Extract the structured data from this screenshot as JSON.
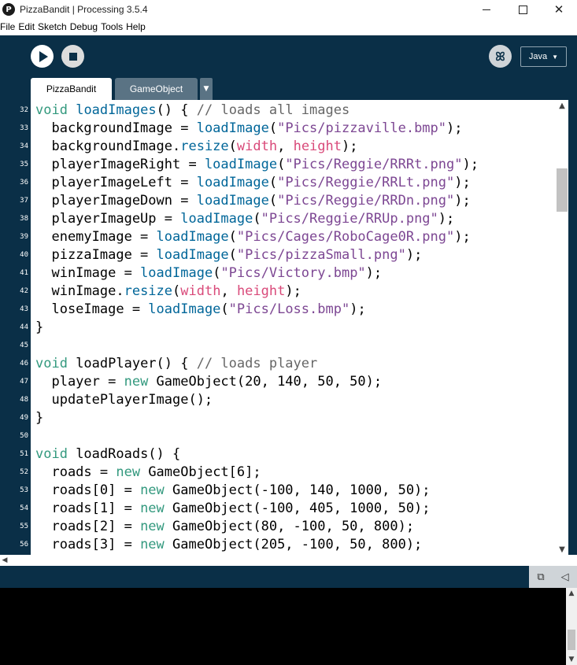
{
  "window": {
    "title": "PizzaBandit | Processing 3.5.4",
    "logo_glyph": "P",
    "minimize_label": "",
    "close_glyph": "✕"
  },
  "menu": [
    "File",
    "Edit",
    "Sketch",
    "Debug",
    "Tools",
    "Help"
  ],
  "toolbar": {
    "run_icon": "play-icon",
    "stop_icon": "stop-icon",
    "debug_icon": "butterfly-debug-icon",
    "debug_glyph": "ꕤ",
    "mode": "Java",
    "mode_chevron": "▼"
  },
  "tabs": [
    {
      "label": "PizzaBandit",
      "active": true
    },
    {
      "label": "GameObject",
      "active": false
    }
  ],
  "tab_menu_glyph": "▼",
  "editor": {
    "first_line": 32,
    "lines": [
      [
        [
          "kw",
          "void"
        ],
        [
          "t",
          " "
        ],
        [
          "fn",
          "loadImages"
        ],
        [
          "t",
          "() { "
        ],
        [
          "cm",
          "// loads all images"
        ]
      ],
      [
        [
          "t",
          "  backgroundImage = "
        ],
        [
          "fn",
          "loadImage"
        ],
        [
          "t",
          "("
        ],
        [
          "str",
          "\"Pics/pizzaville.bmp\""
        ],
        [
          "t",
          ");"
        ]
      ],
      [
        [
          "t",
          "  backgroundImage."
        ],
        [
          "fn",
          "resize"
        ],
        [
          "t",
          "("
        ],
        [
          "var",
          "width"
        ],
        [
          "t",
          ", "
        ],
        [
          "var",
          "height"
        ],
        [
          "t",
          ");"
        ]
      ],
      [
        [
          "t",
          "  playerImageRight = "
        ],
        [
          "fn",
          "loadImage"
        ],
        [
          "t",
          "("
        ],
        [
          "str",
          "\"Pics/Reggie/RRRt.png\""
        ],
        [
          "t",
          ");"
        ]
      ],
      [
        [
          "t",
          "  playerImageLeft = "
        ],
        [
          "fn",
          "loadImage"
        ],
        [
          "t",
          "("
        ],
        [
          "str",
          "\"Pics/Reggie/RRLt.png\""
        ],
        [
          "t",
          ");"
        ]
      ],
      [
        [
          "t",
          "  playerImageDown = "
        ],
        [
          "fn",
          "loadImage"
        ],
        [
          "t",
          "("
        ],
        [
          "str",
          "\"Pics/Reggie/RRDn.png\""
        ],
        [
          "t",
          ");"
        ]
      ],
      [
        [
          "t",
          "  playerImageUp = "
        ],
        [
          "fn",
          "loadImage"
        ],
        [
          "t",
          "("
        ],
        [
          "str",
          "\"Pics/Reggie/RRUp.png\""
        ],
        [
          "t",
          ");"
        ]
      ],
      [
        [
          "t",
          "  enemyImage = "
        ],
        [
          "fn",
          "loadImage"
        ],
        [
          "t",
          "("
        ],
        [
          "str",
          "\"Pics/Cages/RoboCage0R.png\""
        ],
        [
          "t",
          ");"
        ]
      ],
      [
        [
          "t",
          "  pizzaImage = "
        ],
        [
          "fn",
          "loadImage"
        ],
        [
          "t",
          "("
        ],
        [
          "str",
          "\"Pics/pizzaSmall.png\""
        ],
        [
          "t",
          ");"
        ]
      ],
      [
        [
          "t",
          "  winImage = "
        ],
        [
          "fn",
          "loadImage"
        ],
        [
          "t",
          "("
        ],
        [
          "str",
          "\"Pics/Victory.bmp\""
        ],
        [
          "t",
          ");"
        ]
      ],
      [
        [
          "t",
          "  winImage."
        ],
        [
          "fn",
          "resize"
        ],
        [
          "t",
          "("
        ],
        [
          "var",
          "width"
        ],
        [
          "t",
          ", "
        ],
        [
          "var",
          "height"
        ],
        [
          "t",
          ");"
        ]
      ],
      [
        [
          "t",
          "  loseImage = "
        ],
        [
          "fn",
          "loadImage"
        ],
        [
          "t",
          "("
        ],
        [
          "str",
          "\"Pics/Loss.bmp\""
        ],
        [
          "t",
          ");"
        ]
      ],
      [
        [
          "t",
          "}"
        ]
      ],
      [
        [
          "t",
          ""
        ]
      ],
      [
        [
          "kw",
          "void"
        ],
        [
          "t",
          " loadPlayer() { "
        ],
        [
          "cm",
          "// loads player"
        ]
      ],
      [
        [
          "t",
          "  player = "
        ],
        [
          "kw",
          "new"
        ],
        [
          "t",
          " GameObject(20, 140, 50, 50);"
        ]
      ],
      [
        [
          "t",
          "  updatePlayerImage();"
        ]
      ],
      [
        [
          "t",
          "}"
        ]
      ],
      [
        [
          "t",
          ""
        ]
      ],
      [
        [
          "kw",
          "void"
        ],
        [
          "t",
          " loadRoads() {"
        ]
      ],
      [
        [
          "t",
          "  roads = "
        ],
        [
          "kw",
          "new"
        ],
        [
          "t",
          " GameObject[6];"
        ]
      ],
      [
        [
          "t",
          "  roads[0] = "
        ],
        [
          "kw",
          "new"
        ],
        [
          "t",
          " GameObject(-100, 140, 1000, 50);"
        ]
      ],
      [
        [
          "t",
          "  roads[1] = "
        ],
        [
          "kw",
          "new"
        ],
        [
          "t",
          " GameObject(-100, 405, 1000, 50);"
        ]
      ],
      [
        [
          "t",
          "  roads[2] = "
        ],
        [
          "kw",
          "new"
        ],
        [
          "t",
          " GameObject(80, -100, 50, 800);"
        ]
      ],
      [
        [
          "t",
          "  roads[3] = "
        ],
        [
          "kw",
          "new"
        ],
        [
          "t",
          " GameObject(205, -100, 50, 800);"
        ]
      ]
    ]
  },
  "scroll": {
    "up_glyph": "▲",
    "down_glyph": "▼",
    "left_glyph": "◀",
    "vertical_position": 0.2
  },
  "console_tools": {
    "copy_icon": "clipboard-icon",
    "copy_glyph": "⧉",
    "collapse_icon": "collapse-triangle-icon",
    "collapse_glyph": "◁"
  },
  "colors": {
    "chrome": "#0a2f47",
    "keyword": "#33997e",
    "function": "#006699",
    "string": "#7d4793",
    "comment": "#666666",
    "builtin_var": "#d94a7a"
  }
}
